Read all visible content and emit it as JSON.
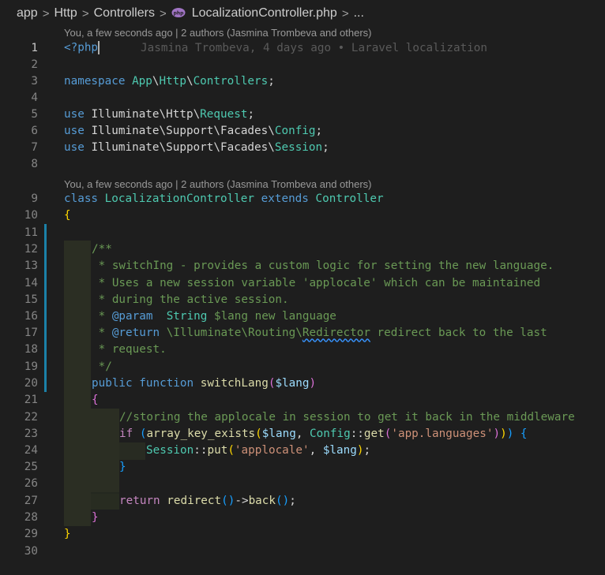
{
  "breadcrumb": {
    "items": [
      "app",
      "Http",
      "Controllers",
      "LocalizationController.php",
      "..."
    ],
    "separator": ">"
  },
  "codelens": {
    "line1": "You, a few seconds ago | 2 authors (Jasmina Trombeva and others)",
    "line9": "You, a few seconds ago | 2 authors (Jasmina Trombeva and others)"
  },
  "blame": {
    "line1": "Jasmina Trombeva, 4 days ago • Laravel localization"
  },
  "line_numbers": [
    "1",
    "2",
    "3",
    "4",
    "5",
    "6",
    "7",
    "8",
    "9",
    "10",
    "11",
    "12",
    "13",
    "14",
    "15",
    "16",
    "17",
    "18",
    "19",
    "20",
    "21",
    "22",
    "23",
    "24",
    "25",
    "26",
    "27",
    "28",
    "29",
    "30"
  ],
  "code": {
    "l1": {
      "open": "<?php"
    },
    "l3": {
      "kw": "namespace",
      "ns1": "App",
      "ns2": "Http",
      "ns3": "Controllers",
      "end": ";"
    },
    "l5": {
      "kw": "use",
      "a": "Illuminate",
      "b": "Http",
      "c": "Request",
      "end": ";"
    },
    "l6": {
      "kw": "use",
      "a": "Illuminate",
      "b": "Support",
      "c": "Facades",
      "d": "Config",
      "end": ";"
    },
    "l7": {
      "kw": "use",
      "a": "Illuminate",
      "b": "Support",
      "c": "Facades",
      "d": "Session",
      "end": ";"
    },
    "l9": {
      "kw": "class",
      "name": "LocalizationController",
      "ext": "extends",
      "parent": "Controller"
    },
    "l10": "{",
    "l12": "/**",
    "l13": " * switchIng - provides a custom logic for setting the new language.",
    "l14": " * Uses a new session variable 'applocale' which can be maintained",
    "l15": " * during the active session.",
    "l16": {
      "star": " * ",
      "tag": "@param",
      "type": "String",
      "rest": "$lang new language"
    },
    "l17": {
      "star": " * ",
      "tag": "@return",
      "a": " \\Illuminate\\Routing\\",
      "b": "Redirector",
      "c": " redirect back to the last"
    },
    "l18": " * request.",
    "l19": " */",
    "l20": {
      "a": "public",
      "b": "function",
      "c": "switchLang",
      "p1": "(",
      "v": "$lang",
      "p2": ")"
    },
    "l21": "{",
    "l22": "//storing the applocale in session to get it back in the middleware",
    "l23": {
      "kw": "if",
      "p1": " (",
      "fn": "array_key_exists",
      "p2": "(",
      "v": "$lang",
      "c1": ", ",
      "cls": "Config",
      "dc": "::",
      "fn2": "get",
      "p3": "(",
      "s": "'app.languages'",
      "p4": "))",
      "p5": ")",
      "br": " {"
    },
    "l24": {
      "cls": "Session",
      "dc": "::",
      "fn": "put",
      "p1": "(",
      "s": "'applocale'",
      "c": ", ",
      "v": "$lang",
      "p2": ")",
      "end": ";"
    },
    "l25": "}",
    "l27": {
      "kw": "return",
      "fn": "redirect",
      "p": "()",
      "ar": "->",
      "fn2": "back",
      "p2": "()",
      "end": ";"
    },
    "l28": "}",
    "l29": "}"
  }
}
